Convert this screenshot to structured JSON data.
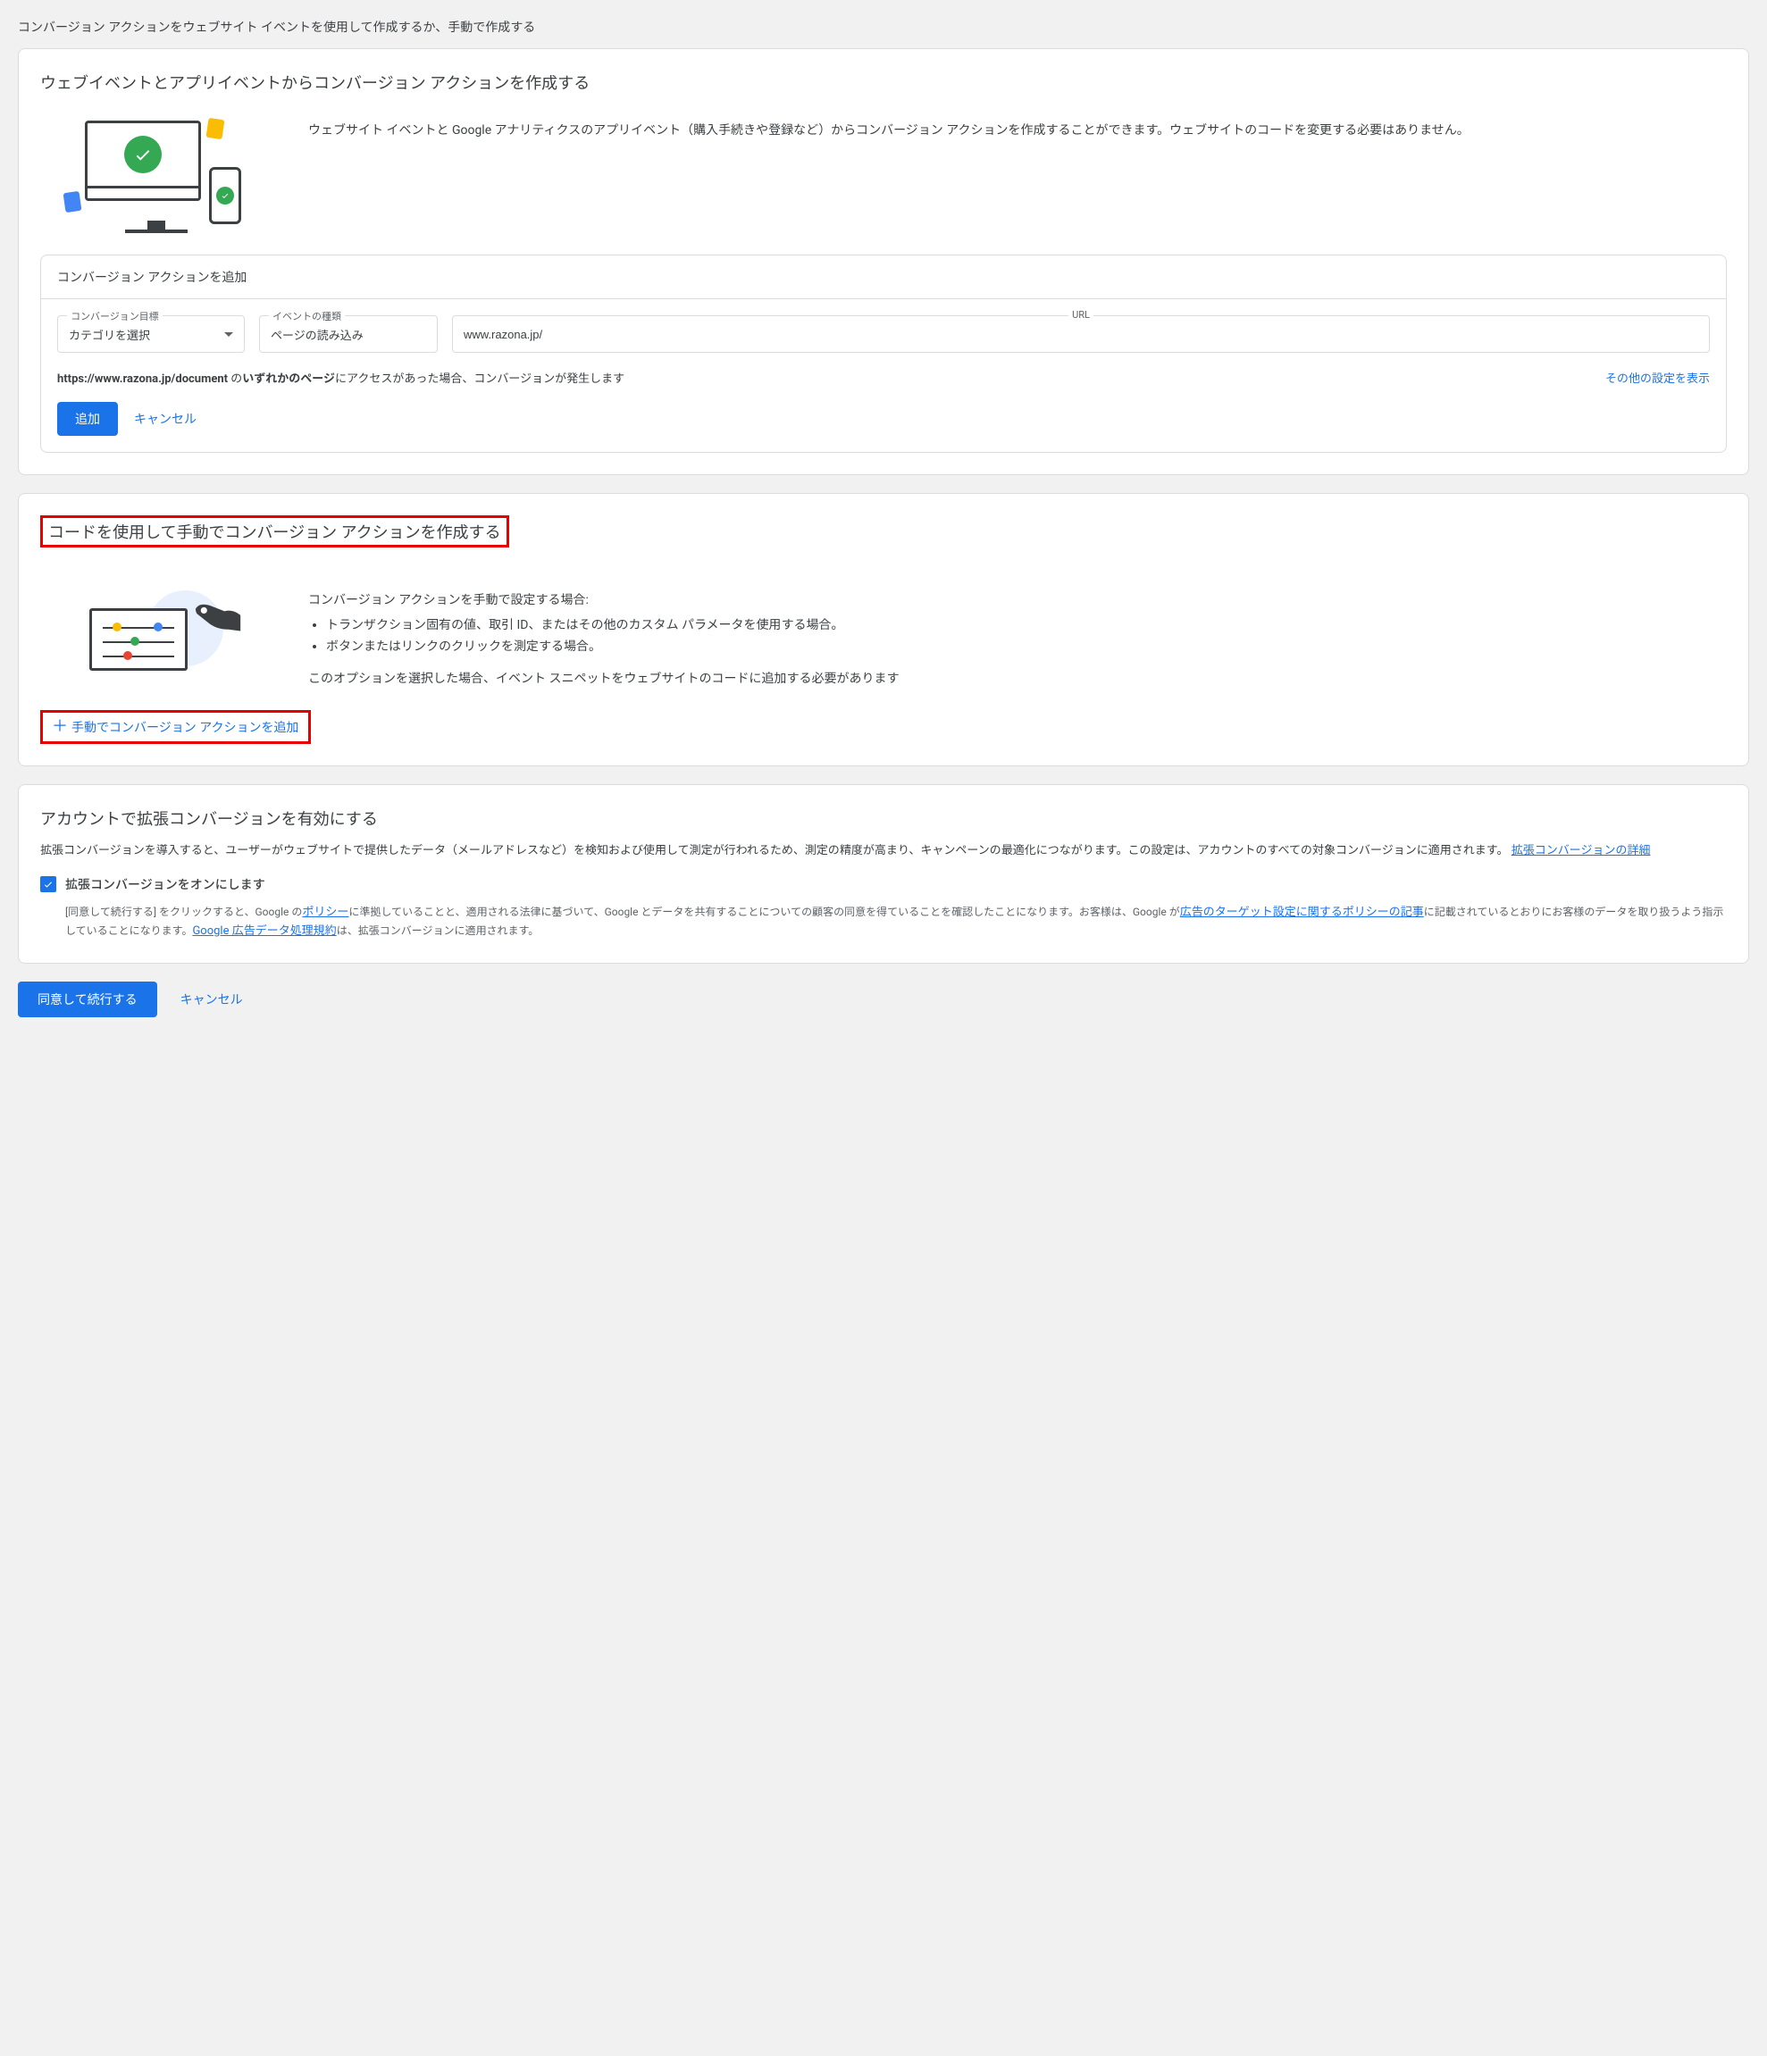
{
  "page": {
    "subtitle": "コンバージョン アクションをウェブサイト イベントを使用して作成するか、手動で作成する"
  },
  "section1": {
    "title": "ウェブイベントとアプリイベントからコンバージョン アクションを作成する",
    "desc": "ウェブサイト イベントと Google アナリティクスのアプリイベント（購入手続きや登録など）からコンバージョン アクションを作成することができます。ウェブサイトのコードを変更する必要はありません。",
    "subpanel_title": "コンバージョン アクションを追加",
    "field_goal_label": "コンバージョン目標",
    "field_goal_value": "カテゴリを選択",
    "field_event_label": "イベントの種類",
    "field_event_value": "ページの読み込み",
    "field_url_label": "URL",
    "field_url_value": "www.razona.jp/",
    "match_text_pre": "https://www.razona.jp/document",
    "match_text_mid": " の",
    "match_text_bold": "いずれかのページ",
    "match_text_post": "にアクセスがあった場合、コンバージョンが発生します",
    "show_other": "その他の設定を表示",
    "add_btn": "追加",
    "cancel_btn": "キャンセル"
  },
  "section2": {
    "title": "コードを使用して手動でコンバージョン アクションを作成する",
    "lead": "コンバージョン アクションを手動で設定する場合:",
    "li1": "トランザクション固有の値、取引 ID、またはその他のカスタム パラメータを使用する場合。",
    "li2": "ボタンまたはリンクのクリックを測定する場合。",
    "note": "このオプションを選択した場合、イベント スニペットをウェブサイトのコードに追加する必要があります",
    "add_manual": "手動でコンバージョン アクションを追加"
  },
  "section3": {
    "title": "アカウントで拡張コンバージョンを有効にする",
    "desc_a": "拡張コンバージョンを導入すると、ユーザーがウェブサイトで提供したデータ（メールアドレスなど）を検知および使用して測定が行われるため、測定の精度が高まり、キャンペーンの最適化につながります。この設定は、アカウントのすべての対象コンバージョンに適用されます。",
    "desc_link": "拡張コンバージョンの詳細",
    "checkbox_label": "拡張コンバージョンをオンにします",
    "fine_a": "[同意して続行する] をクリックすると、Google の",
    "fine_link1": "ポリシー",
    "fine_b": "に準拠していることと、適用される法律に基づいて、Google とデータを共有することについての顧客の同意を得ていることを確認したことになります。お客様は、Google が",
    "fine_link2": "広告のターゲット設定に関するポリシーの記事",
    "fine_c": "に記載されているとおりにお客様のデータを取り扱うよう指示していることになります。",
    "fine_link3": "Google 広告データ処理規約",
    "fine_d": "は、拡張コンバージョンに適用されます。"
  },
  "footer": {
    "agree": "同意して続行する",
    "cancel": "キャンセル"
  }
}
